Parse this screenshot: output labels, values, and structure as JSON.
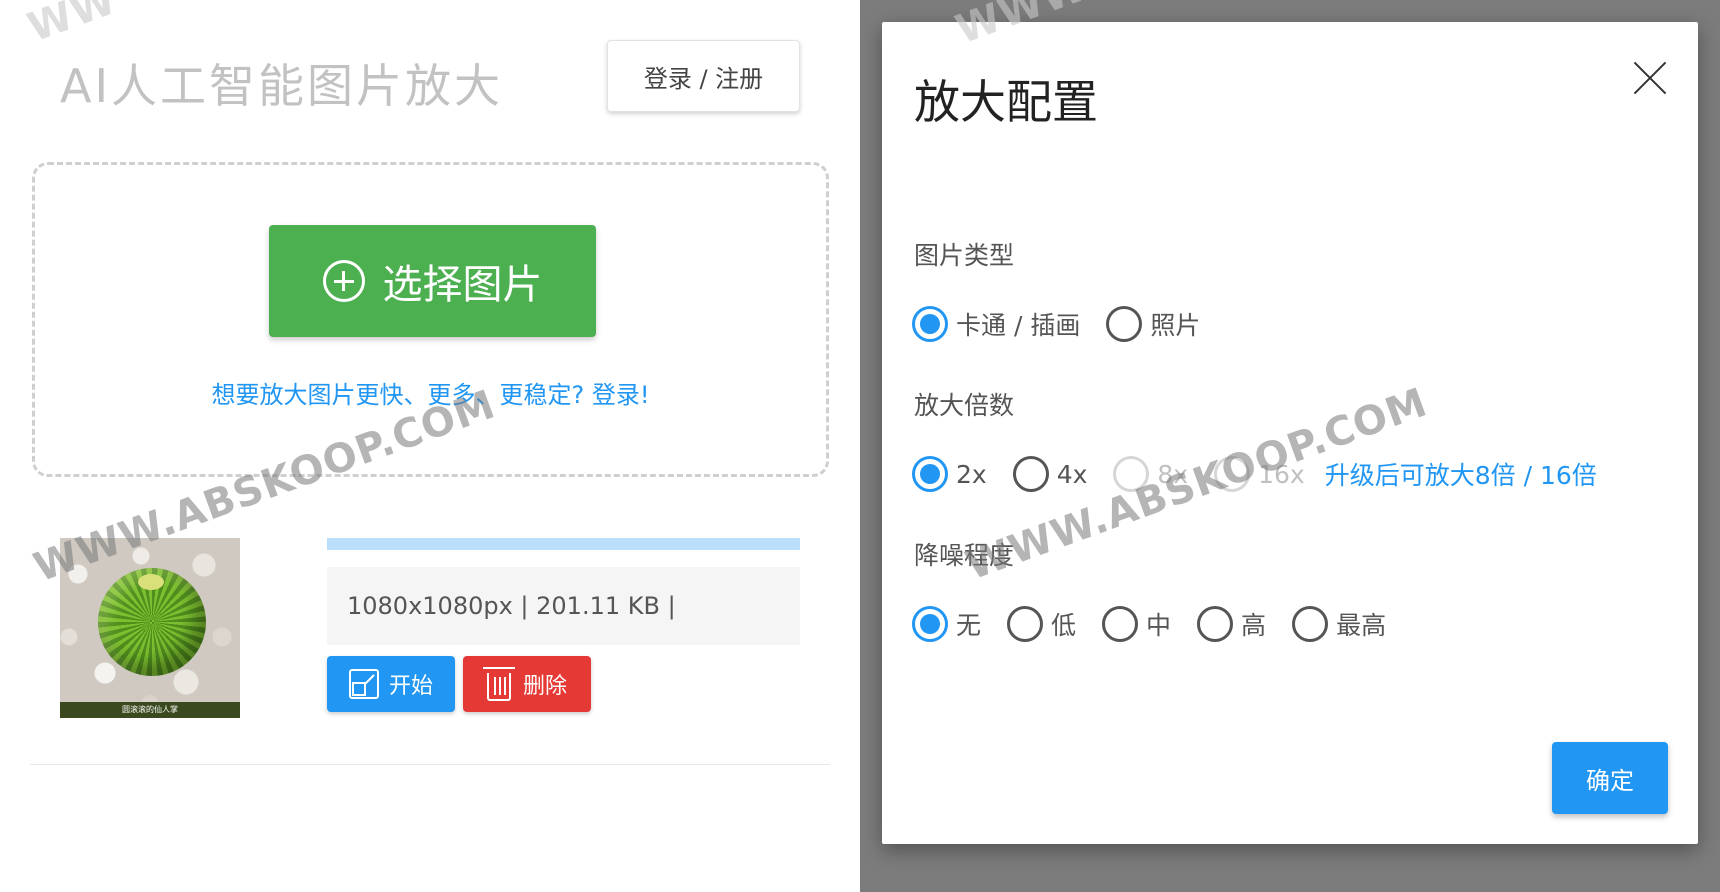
{
  "app": {
    "title": "AI人工智能图片放大",
    "login_button": "登录 / 注册"
  },
  "upload": {
    "select_button": "选择图片",
    "login_hint": "想要放大图片更快、更多、更稳定? 登录!"
  },
  "file": {
    "thumbnail_caption": "圆滚滚的仙人掌",
    "info": "1080x1080px | 201.11 KB |",
    "progress": 1.0,
    "start_button": "开始",
    "delete_button": "删除"
  },
  "modal": {
    "title": "放大配置",
    "image_type": {
      "label": "图片类型",
      "options": [
        {
          "label": "卡通 / 插画",
          "checked": true,
          "disabled": false
        },
        {
          "label": "照片",
          "checked": false,
          "disabled": false
        }
      ]
    },
    "scale": {
      "label": "放大倍数",
      "options": [
        {
          "label": "2x",
          "checked": true,
          "disabled": false
        },
        {
          "label": "4x",
          "checked": false,
          "disabled": false
        },
        {
          "label": "8x",
          "checked": false,
          "disabled": true
        },
        {
          "label": "16x",
          "checked": false,
          "disabled": true
        }
      ],
      "upgrade_link": "升级后可放大8倍 / 16倍"
    },
    "denoise": {
      "label": "降噪程度",
      "options": [
        {
          "label": "无",
          "checked": true,
          "disabled": false
        },
        {
          "label": "低",
          "checked": false,
          "disabled": false
        },
        {
          "label": "中",
          "checked": false,
          "disabled": false
        },
        {
          "label": "高",
          "checked": false,
          "disabled": false
        },
        {
          "label": "最高",
          "checked": false,
          "disabled": false
        }
      ]
    },
    "confirm_button": "确定"
  },
  "watermark": {
    "text": "WWW.ABSKOOP.COM",
    "partial_1": "WW",
    "partial_2": "WWW"
  },
  "colors": {
    "primary": "#2196f3",
    "success": "#4caf50",
    "danger": "#e53935",
    "overlay": "#7c7c7c"
  }
}
